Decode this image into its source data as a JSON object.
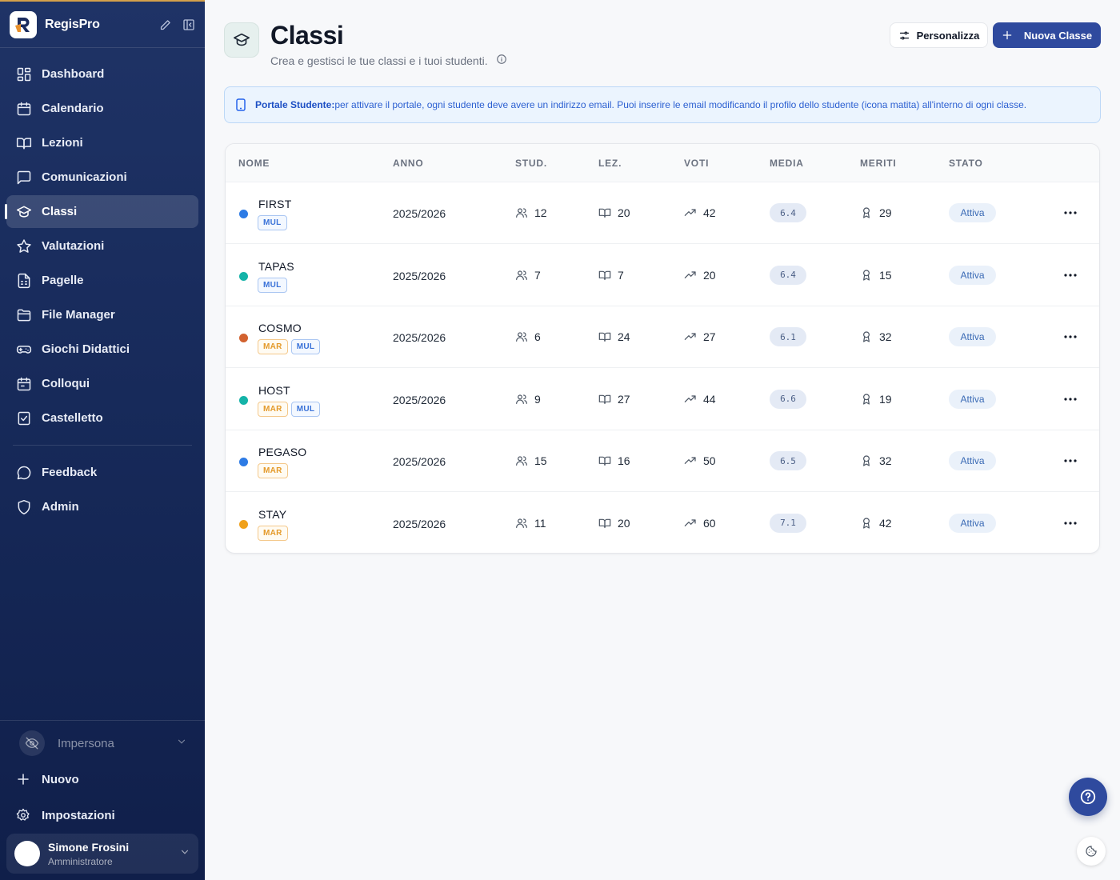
{
  "app": {
    "name": "RegisPro"
  },
  "sidebar": {
    "items": [
      {
        "label": "Dashboard",
        "icon": "dashboard-icon"
      },
      {
        "label": "Calendario",
        "icon": "calendar-icon"
      },
      {
        "label": "Lezioni",
        "icon": "book-open-icon"
      },
      {
        "label": "Comunicazioni",
        "icon": "message-square-icon"
      },
      {
        "label": "Classi",
        "icon": "graduation-cap-icon",
        "active": true
      },
      {
        "label": "Valutazioni",
        "icon": "star-icon"
      },
      {
        "label": "Pagelle",
        "icon": "report-card-icon"
      },
      {
        "label": "File Manager",
        "icon": "folder-icon"
      },
      {
        "label": "Giochi Didattici",
        "icon": "gamepad-icon"
      },
      {
        "label": "Colloqui",
        "icon": "calendar-meeting-icon"
      },
      {
        "label": "Castelletto",
        "icon": "checklist-icon"
      }
    ],
    "secondary": [
      {
        "label": "Feedback",
        "icon": "feedback-icon"
      },
      {
        "label": "Admin",
        "icon": "shield-icon"
      }
    ],
    "impersona": "Impersona",
    "new_label": "Nuovo",
    "settings_label": "Impostazioni",
    "user": {
      "name": "Simone Frosini",
      "role": "Amministratore"
    }
  },
  "page": {
    "title": "Classi",
    "subtitle": "Crea e gestisci le tue classi e i tuoi studenti.",
    "customize_label": "Personalizza",
    "new_class_label": "Nuova Classe"
  },
  "banner": {
    "title": "Portale Studente:",
    "text": "per attivare il portale, ogni studente deve avere un indirizzo email. Puoi inserire le email modificando il profilo dello studente (icona matita) all'interno di ogni classe."
  },
  "table": {
    "headers": [
      "NOME",
      "ANNO",
      "STUD.",
      "LEZ.",
      "VOTI",
      "MEDIA",
      "MERITI",
      "STATO"
    ],
    "rows": [
      {
        "name": "FIRST",
        "dot_color": "#2d7be5",
        "tags": [
          "MUL"
        ],
        "year": "2025/2026",
        "students": "12",
        "lessons": "20",
        "grades": "42",
        "average": "6.4",
        "merits": "29",
        "status": "Attiva"
      },
      {
        "name": "TAPAS",
        "dot_color": "#14b3a8",
        "tags": [
          "MUL"
        ],
        "year": "2025/2026",
        "students": "7",
        "lessons": "7",
        "grades": "20",
        "average": "6.4",
        "merits": "15",
        "status": "Attiva"
      },
      {
        "name": "COSMO",
        "dot_color": "#d2622f",
        "tags": [
          "MAR",
          "MUL"
        ],
        "year": "2025/2026",
        "students": "6",
        "lessons": "24",
        "grades": "27",
        "average": "6.1",
        "merits": "32",
        "status": "Attiva"
      },
      {
        "name": "HOST",
        "dot_color": "#14b3a8",
        "tags": [
          "MAR",
          "MUL"
        ],
        "year": "2025/2026",
        "students": "9",
        "lessons": "27",
        "grades": "44",
        "average": "6.6",
        "merits": "19",
        "status": "Attiva"
      },
      {
        "name": "PEGASO",
        "dot_color": "#2d7be5",
        "tags": [
          "MAR"
        ],
        "year": "2025/2026",
        "students": "15",
        "lessons": "16",
        "grades": "50",
        "average": "6.5",
        "merits": "32",
        "status": "Attiva"
      },
      {
        "name": "STAY",
        "dot_color": "#f0a11b",
        "tags": [
          "MAR"
        ],
        "year": "2025/2026",
        "students": "11",
        "lessons": "20",
        "grades": "60",
        "average": "7.1",
        "merits": "42",
        "status": "Attiva"
      }
    ]
  },
  "colors": {
    "primary": "#2f4a9e",
    "sidebar": "#172a5a",
    "accent": "#d4a04a"
  }
}
